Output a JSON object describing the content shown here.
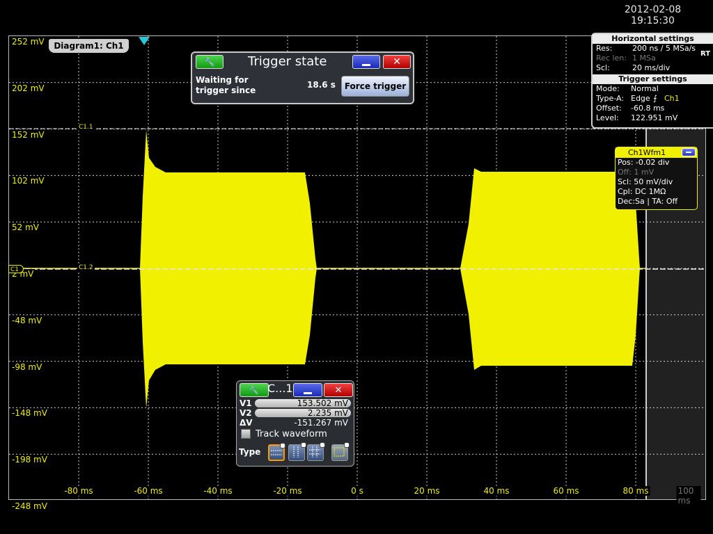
{
  "datetime": {
    "date": "2012-02-08",
    "time": "19:15:30"
  },
  "diagram": {
    "tab_label": "Diagram1: Ch1",
    "y_labels": [
      "252 mV",
      "202 mV",
      "152 mV",
      "102 mV",
      "52 mV",
      "2 mV",
      "-48 mV",
      "-98 mV",
      "-148 mV",
      "-198 mV",
      "-248 mV"
    ],
    "x_labels": [
      "-80 ms",
      "-60 ms",
      "-40 ms",
      "-20 ms",
      "0 s",
      "20 ms",
      "40 ms",
      "60 ms",
      "80 ms",
      "100 ms"
    ],
    "cursor_1_label": "C1.1",
    "cursor_2_label": "C1.2",
    "channel_marker": "C1",
    "waveform_color": "#f0f000"
  },
  "trigger_state": {
    "title": "Trigger state",
    "waiting_text_line1": "Waiting for",
    "waiting_text_line2": "trigger since",
    "elapsed": "18.6 s",
    "force_button": "Force trigger"
  },
  "horizontal_settings": {
    "title": "Horizontal settings",
    "res_label": "Res:",
    "res_value": "200 ns / 5 MSa/s",
    "rt_badge": "RT",
    "reclen_label": "Rec len:",
    "reclen_value": "1 MSa",
    "scl_label": "Scl:",
    "scl_value": "20 ms/div"
  },
  "trigger_settings": {
    "title": "Trigger settings",
    "mode_label": "Mode:",
    "mode_value": "Normal",
    "type_label": "Type-A:",
    "type_value": "Edge",
    "type_source": "Ch1",
    "offset_label": "Offset:",
    "offset_value": "-60.8 ms",
    "level_label": "Level:",
    "level_value": "122.951 mV"
  },
  "ch1wfm": {
    "title": "Ch1Wfm1",
    "pos": "Pos: -0.02 div",
    "off": "Off: 1 mV",
    "scl": "Scl: 50 mV/div",
    "cpl": "Cpl: DC 1MΩ",
    "dec": "Dec:Sa | TA: Off"
  },
  "cursor_panel": {
    "title": "C...1",
    "v1_label": "V1",
    "v1_value": "153.502 mV",
    "v2_label": "V2",
    "v2_value": "2.235 mV",
    "dv_label": "ΔV",
    "dv_value": "-151.267 mV",
    "track_label": "Track waveform",
    "type_label": "Type"
  }
}
